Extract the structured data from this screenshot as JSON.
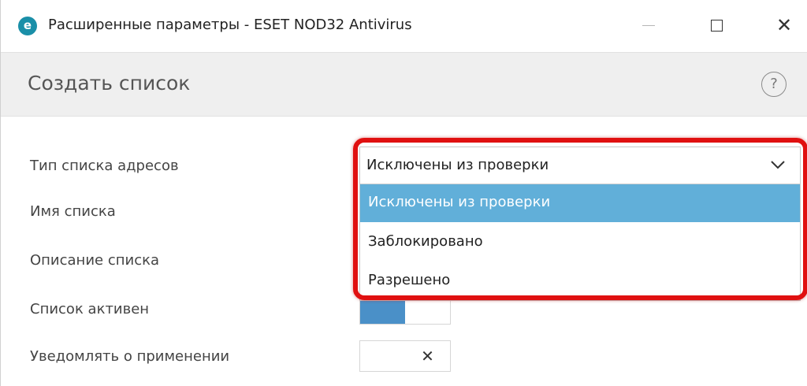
{
  "window": {
    "title": "Расширенные параметры - ESET NOD32 Antivirus",
    "app_icon_letter": "e",
    "icons": {
      "app": "eset-logo-icon",
      "minimize": "minimize-icon",
      "maximize": "maximize-icon",
      "close": "close-icon"
    },
    "close_glyph": "✕"
  },
  "header": {
    "title": "Создать список",
    "help_glyph": "?"
  },
  "form": {
    "list_type_label": "Тип списка адресов",
    "list_name_label": "Имя списка",
    "list_description_label": "Описание списка",
    "list_active_label": "Список активен",
    "notify_label": "Уведомлять о применении"
  },
  "dropdown": {
    "selected_value": "Исключены из проверки",
    "options": [
      "Исключены из проверки",
      "Заблокировано",
      "Разрешено"
    ],
    "highlighted_index": 0
  },
  "toggles": {
    "list_active": true,
    "notify": false,
    "off_glyph": "✕"
  },
  "colors": {
    "accent_blue": "#61afd9",
    "toggle_on": "#4a90c8",
    "highlight_red": "#e01010",
    "header_bg": "#efefef"
  }
}
